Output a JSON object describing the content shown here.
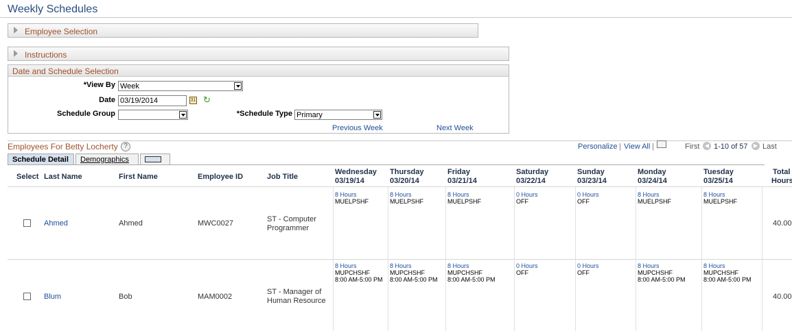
{
  "page_title": "Weekly Schedules",
  "sections": {
    "employee_selection": "Employee Selection",
    "instructions": "Instructions",
    "date_schedule": "Date and Schedule Selection"
  },
  "form": {
    "view_by_label": "*View By",
    "view_by_value": "Week",
    "date_label": "Date",
    "date_value": "03/19/2014",
    "schedule_group_label": "Schedule Group",
    "schedule_group_value": "",
    "schedule_type_label": "*Schedule Type",
    "schedule_type_value": "Primary",
    "prev_week": "Previous Week",
    "next_week": "Next Week"
  },
  "grid": {
    "title": "Employees For Betty Locherty",
    "personalize": "Personalize",
    "view_all": "View All",
    "first": "First",
    "range": "1-10 of 57",
    "last": "Last",
    "tabs": [
      "Schedule Detail",
      "Demographics"
    ],
    "headers": {
      "select": "Select",
      "last_name": "Last Name",
      "first_name": "First Name",
      "employee_id": "Employee ID",
      "job_title": "Job Title",
      "days": [
        {
          "day": "Wednesday",
          "date": "03/19/14"
        },
        {
          "day": "Thursday",
          "date": "03/20/14"
        },
        {
          "day": "Friday",
          "date": "03/21/14"
        },
        {
          "day": "Saturday",
          "date": "03/22/14"
        },
        {
          "day": "Sunday",
          "date": "03/23/14"
        },
        {
          "day": "Monday",
          "date": "03/24/14"
        },
        {
          "day": "Tuesday",
          "date": "03/25/14"
        }
      ],
      "total": "Total",
      "hours": "Hours"
    },
    "rows": [
      {
        "last_name": "Ahmed",
        "first_name": "Ahmed",
        "employee_id": "MWC0027",
        "job_title_1": "ST - Computer",
        "job_title_2": "Programmer",
        "days": [
          {
            "hours": "8 Hours",
            "code": "MUELPSHF",
            "time": ""
          },
          {
            "hours": "8 Hours",
            "code": "MUELPSHF",
            "time": ""
          },
          {
            "hours": "8 Hours",
            "code": "MUELPSHF",
            "time": ""
          },
          {
            "hours": "0 Hours",
            "code": "OFF",
            "time": ""
          },
          {
            "hours": "0 Hours",
            "code": "OFF",
            "time": ""
          },
          {
            "hours": "8 Hours",
            "code": "MUELPSHF",
            "time": ""
          },
          {
            "hours": "8 Hours",
            "code": "MUELPSHF",
            "time": ""
          }
        ],
        "total": "40.00"
      },
      {
        "last_name": "Blum",
        "first_name": "Bob",
        "employee_id": "MAM0002",
        "job_title_1": "ST - Manager of",
        "job_title_2": "Human Resource",
        "days": [
          {
            "hours": "8 Hours",
            "code": "MUPCHSHF",
            "time": "8:00 AM-5:00 PM"
          },
          {
            "hours": "8 Hours",
            "code": "MUPCHSHF",
            "time": "8:00 AM-5:00 PM"
          },
          {
            "hours": "8 Hours",
            "code": "MUPCHSHF",
            "time": "8:00 AM-5:00 PM"
          },
          {
            "hours": "0 Hours",
            "code": "OFF",
            "time": ""
          },
          {
            "hours": "0 Hours",
            "code": "OFF",
            "time": ""
          },
          {
            "hours": "8 Hours",
            "code": "MUPCHSHF",
            "time": "8:00 AM-5:00 PM"
          },
          {
            "hours": "8 Hours",
            "code": "MUPCHSHF",
            "time": "8:00 AM-5:00 PM"
          }
        ],
        "total": "40.00"
      }
    ]
  },
  "colors": {
    "title": "#2b4c7e",
    "section_label": "#a0512b",
    "link": "#1f4e99",
    "tab_active": "#d6e1ee"
  }
}
